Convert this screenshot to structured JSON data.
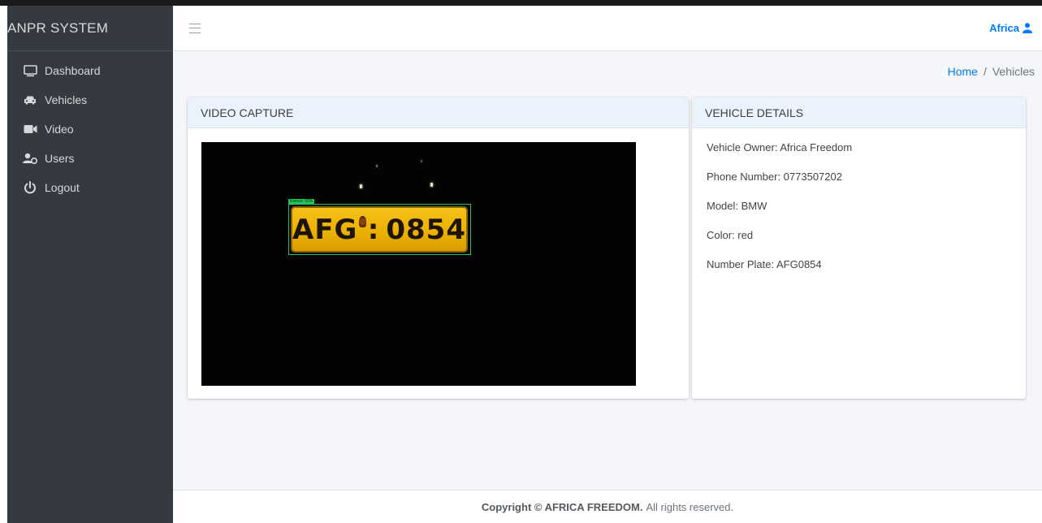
{
  "sidebar": {
    "brand": "ANPR SYSTEM",
    "items": [
      {
        "label": "Dashboard",
        "icon": "monitor-icon"
      },
      {
        "label": "Vehicles",
        "icon": "car-icon"
      },
      {
        "label": "Video",
        "icon": "video-camera-icon"
      },
      {
        "label": "Users",
        "icon": "users-icon"
      },
      {
        "label": "Logout",
        "icon": "power-icon"
      }
    ]
  },
  "header": {
    "menu_icon": "hamburger-icon",
    "user_name": "Africa",
    "user_icon": "user-icon"
  },
  "breadcrumb": {
    "home": "Home",
    "separator": "/",
    "current": "Vehicles"
  },
  "video_card": {
    "title": "VIDEO CAPTURE",
    "detection_label": "licence: 92%",
    "plate_left": "AFG",
    "plate_sep": ":",
    "plate_right": "0854"
  },
  "details_card": {
    "title": "VEHICLE DETAILS",
    "owner": "Vehicle Owner: Africa Freedom",
    "phone": "Phone Number: 0773507202",
    "model": "Model: BMW",
    "color": "Color: red",
    "plate": "Number Plate: AFG0854"
  },
  "footer": {
    "copyright": "Copyright © AFRICA FREEDOM.",
    "rights": "All rights reserved."
  },
  "colors": {
    "sidebar_bg": "#343a40",
    "accent": "#007bff",
    "content_bg": "#f4f6f9",
    "card_header_bg": "#eaf2fb",
    "detection_box": "#22c55e",
    "plate_yellow": "#f7c11a"
  }
}
